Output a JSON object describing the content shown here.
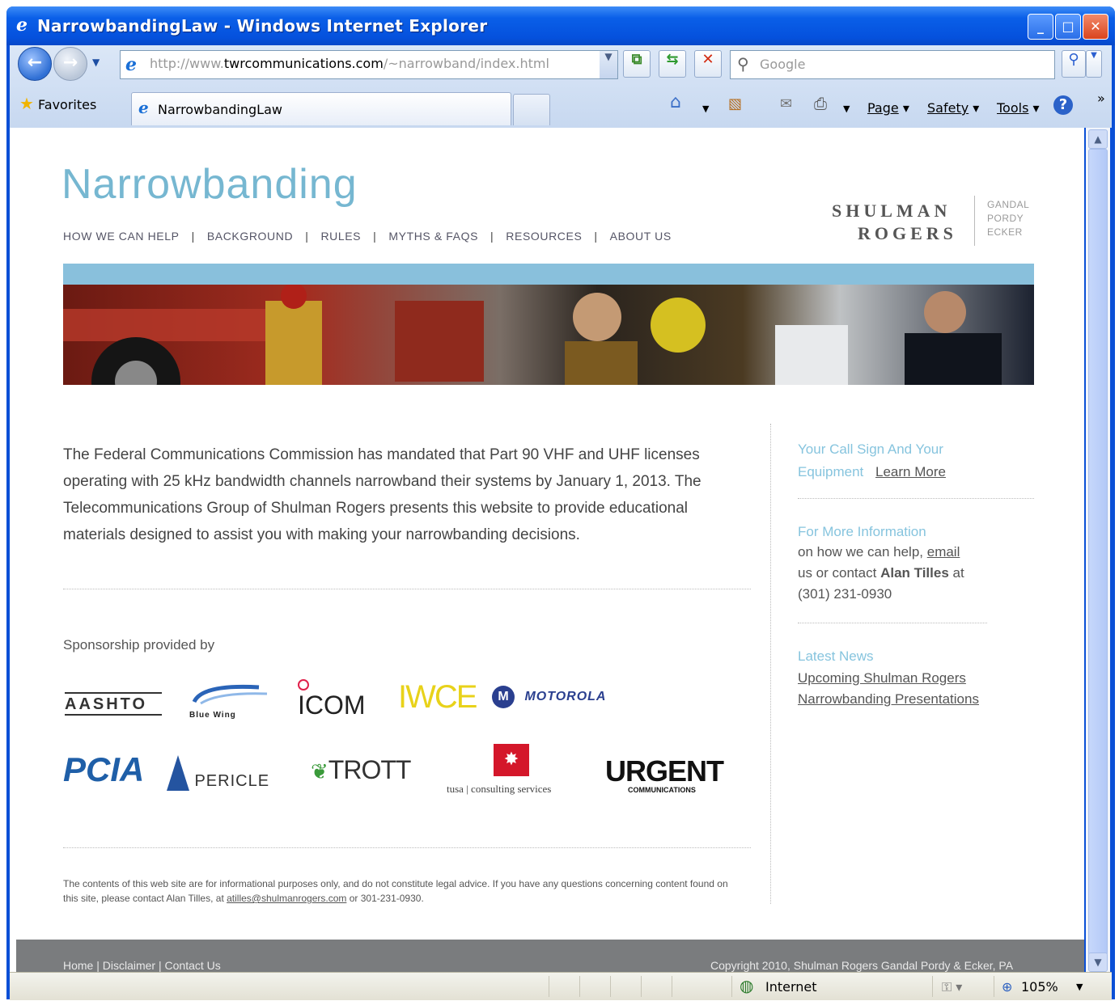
{
  "window": {
    "title": "NarrowbandingLaw - Windows Internet Explorer",
    "minimize": "_",
    "maximize": "□",
    "close": "✕"
  },
  "toolbar": {
    "address_prefix": "http://www.",
    "address_domain": "twrcommunications.com",
    "address_path": "/~narrowband/index.html",
    "search_placeholder": "Google",
    "favorites": "Favorites",
    "tab_title": "NarrowbandingLaw",
    "page_menu": "Page",
    "safety_menu": "Safety",
    "tools_menu": "Tools",
    "more": "»"
  },
  "header": {
    "logo": "Narrowbanding",
    "nav": [
      "HOW WE CAN HELP",
      "BACKGROUND",
      "RULES",
      "MYTHS & FAQS",
      "RESOURCES",
      "ABOUT US"
    ],
    "nav_separator": "|",
    "firm_line1": "SHULMAN",
    "firm_line2": "ROGERS",
    "firm_small": [
      "GANDAL",
      "PORDY",
      "ECKER"
    ]
  },
  "main": {
    "intro": "The Federal Communications Commission has mandated that Part 90 VHF and UHF licenses operating with 25 kHz bandwidth channels narrowband their systems by January 1, 2013. The Telecommunications Group of Shulman Rogers presents this website to provide educational materials designed to assist you with making your narrowbanding decisions.",
    "sponsorship_label": "Sponsorship provided by",
    "sponsors": {
      "aashto": "AASHTO",
      "bluewing": "Blue Wing",
      "icom": "ICOM",
      "iwce": "IWCE",
      "motorola": "MOTOROLA",
      "pcia": "PCIA",
      "pericle": "PERICLE",
      "trott": "TROTT",
      "tusa": "tusa | consulting services",
      "urgent": "URGENT",
      "urgent_sub": "COMMUNICATIONS"
    },
    "legal_text": "The contents of this web site are for informational purposes only, and do not constitute legal advice. If you have any questions concerning content found on this site, please contact Alan Tilles, at",
    "legal_email": "atilles@shulmanrogers.com",
    "legal_phone": "or 301-231-0930."
  },
  "sidebar": {
    "callsign_heading_1": "Your Call Sign And Your",
    "callsign_heading_2": "Equipment",
    "learn_more": "Learn More",
    "more_info_heading": "For More Information",
    "more_info_1": "on how we can help,",
    "email_link": "email",
    "more_info_2": "us or contact",
    "contact_name": "Alan Tilles",
    "more_info_3": "at",
    "phone": "(301) 231-0930",
    "news_heading": "Latest News",
    "news_link_1": "Upcoming Shulman Rogers",
    "news_link_2": "Narrowbanding Presentations"
  },
  "footer": {
    "links": "Home  |  Disclaimer  |  Contact Us",
    "copyright": "Copyright 2010, Shulman Rogers Gandal Pordy & Ecker, PA"
  },
  "statusbar": {
    "zone": "Internet",
    "zoom": "105%"
  }
}
